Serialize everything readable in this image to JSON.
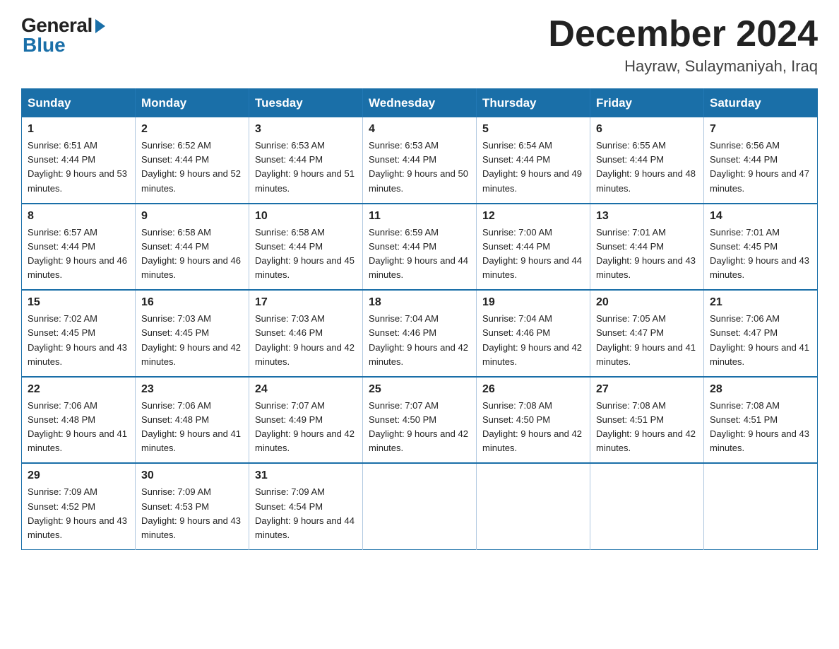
{
  "logo": {
    "general": "General",
    "blue": "Blue"
  },
  "title": "December 2024",
  "location": "Hayraw, Sulaymaniyah, Iraq",
  "days_of_week": [
    "Sunday",
    "Monday",
    "Tuesday",
    "Wednesday",
    "Thursday",
    "Friday",
    "Saturday"
  ],
  "weeks": [
    [
      {
        "day": "1",
        "sunrise": "6:51 AM",
        "sunset": "4:44 PM",
        "daylight": "9 hours and 53 minutes."
      },
      {
        "day": "2",
        "sunrise": "6:52 AM",
        "sunset": "4:44 PM",
        "daylight": "9 hours and 52 minutes."
      },
      {
        "day": "3",
        "sunrise": "6:53 AM",
        "sunset": "4:44 PM",
        "daylight": "9 hours and 51 minutes."
      },
      {
        "day": "4",
        "sunrise": "6:53 AM",
        "sunset": "4:44 PM",
        "daylight": "9 hours and 50 minutes."
      },
      {
        "day": "5",
        "sunrise": "6:54 AM",
        "sunset": "4:44 PM",
        "daylight": "9 hours and 49 minutes."
      },
      {
        "day": "6",
        "sunrise": "6:55 AM",
        "sunset": "4:44 PM",
        "daylight": "9 hours and 48 minutes."
      },
      {
        "day": "7",
        "sunrise": "6:56 AM",
        "sunset": "4:44 PM",
        "daylight": "9 hours and 47 minutes."
      }
    ],
    [
      {
        "day": "8",
        "sunrise": "6:57 AM",
        "sunset": "4:44 PM",
        "daylight": "9 hours and 46 minutes."
      },
      {
        "day": "9",
        "sunrise": "6:58 AM",
        "sunset": "4:44 PM",
        "daylight": "9 hours and 46 minutes."
      },
      {
        "day": "10",
        "sunrise": "6:58 AM",
        "sunset": "4:44 PM",
        "daylight": "9 hours and 45 minutes."
      },
      {
        "day": "11",
        "sunrise": "6:59 AM",
        "sunset": "4:44 PM",
        "daylight": "9 hours and 44 minutes."
      },
      {
        "day": "12",
        "sunrise": "7:00 AM",
        "sunset": "4:44 PM",
        "daylight": "9 hours and 44 minutes."
      },
      {
        "day": "13",
        "sunrise": "7:01 AM",
        "sunset": "4:44 PM",
        "daylight": "9 hours and 43 minutes."
      },
      {
        "day": "14",
        "sunrise": "7:01 AM",
        "sunset": "4:45 PM",
        "daylight": "9 hours and 43 minutes."
      }
    ],
    [
      {
        "day": "15",
        "sunrise": "7:02 AM",
        "sunset": "4:45 PM",
        "daylight": "9 hours and 43 minutes."
      },
      {
        "day": "16",
        "sunrise": "7:03 AM",
        "sunset": "4:45 PM",
        "daylight": "9 hours and 42 minutes."
      },
      {
        "day": "17",
        "sunrise": "7:03 AM",
        "sunset": "4:46 PM",
        "daylight": "9 hours and 42 minutes."
      },
      {
        "day": "18",
        "sunrise": "7:04 AM",
        "sunset": "4:46 PM",
        "daylight": "9 hours and 42 minutes."
      },
      {
        "day": "19",
        "sunrise": "7:04 AM",
        "sunset": "4:46 PM",
        "daylight": "9 hours and 42 minutes."
      },
      {
        "day": "20",
        "sunrise": "7:05 AM",
        "sunset": "4:47 PM",
        "daylight": "9 hours and 41 minutes."
      },
      {
        "day": "21",
        "sunrise": "7:06 AM",
        "sunset": "4:47 PM",
        "daylight": "9 hours and 41 minutes."
      }
    ],
    [
      {
        "day": "22",
        "sunrise": "7:06 AM",
        "sunset": "4:48 PM",
        "daylight": "9 hours and 41 minutes."
      },
      {
        "day": "23",
        "sunrise": "7:06 AM",
        "sunset": "4:48 PM",
        "daylight": "9 hours and 41 minutes."
      },
      {
        "day": "24",
        "sunrise": "7:07 AM",
        "sunset": "4:49 PM",
        "daylight": "9 hours and 42 minutes."
      },
      {
        "day": "25",
        "sunrise": "7:07 AM",
        "sunset": "4:50 PM",
        "daylight": "9 hours and 42 minutes."
      },
      {
        "day": "26",
        "sunrise": "7:08 AM",
        "sunset": "4:50 PM",
        "daylight": "9 hours and 42 minutes."
      },
      {
        "day": "27",
        "sunrise": "7:08 AM",
        "sunset": "4:51 PM",
        "daylight": "9 hours and 42 minutes."
      },
      {
        "day": "28",
        "sunrise": "7:08 AM",
        "sunset": "4:51 PM",
        "daylight": "9 hours and 43 minutes."
      }
    ],
    [
      {
        "day": "29",
        "sunrise": "7:09 AM",
        "sunset": "4:52 PM",
        "daylight": "9 hours and 43 minutes."
      },
      {
        "day": "30",
        "sunrise": "7:09 AM",
        "sunset": "4:53 PM",
        "daylight": "9 hours and 43 minutes."
      },
      {
        "day": "31",
        "sunrise": "7:09 AM",
        "sunset": "4:54 PM",
        "daylight": "9 hours and 44 minutes."
      },
      null,
      null,
      null,
      null
    ]
  ]
}
